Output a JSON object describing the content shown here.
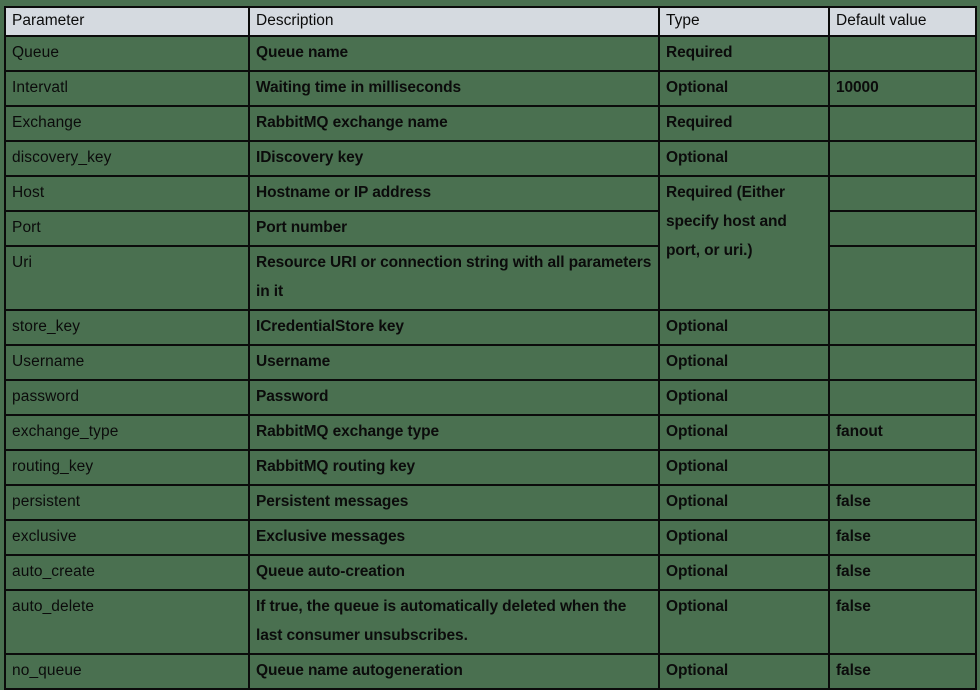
{
  "table": {
    "columns": [
      "Parameter",
      "Description",
      "Type",
      "Default value"
    ],
    "rows": [
      {
        "parameter": "Queue",
        "description": "Queue name",
        "type": "Required",
        "default": ""
      },
      {
        "parameter": "Intervatl",
        "description": "Waiting time in milliseconds",
        "type": "Optional",
        "default": "10000"
      },
      {
        "parameter": "Exchange",
        "description": "RabbitMQ exchange name",
        "type": "Required",
        "default": ""
      },
      {
        "parameter": "discovery_key",
        "description": "IDiscovery key",
        "type": "Optional",
        "default": ""
      },
      {
        "parameter": "Host",
        "description": "Hostname or IP address",
        "type": "Required (Either specify host and port, or uri.)",
        "type_merged_rowspan": 3,
        "default": ""
      },
      {
        "parameter": "Port",
        "description": "Port number",
        "type": null,
        "default": ""
      },
      {
        "parameter": "Uri",
        "description": "Resource URI or connection string with all parameters in it",
        "type": null,
        "default": ""
      },
      {
        "parameter": "store_key",
        "description": "ICredentialStore key",
        "type": "Optional",
        "default": ""
      },
      {
        "parameter": "Username",
        "description": "Username",
        "type": "Optional",
        "default": ""
      },
      {
        "parameter": "password",
        "description": "Password",
        "type": "Optional",
        "default": ""
      },
      {
        "parameter": "exchange_type",
        "description": "RabbitMQ exchange type",
        "type": "Optional",
        "default": "fanout"
      },
      {
        "parameter": "routing_key",
        "description": "RabbitMQ routing key",
        "type": "Optional",
        "default": ""
      },
      {
        "parameter": "persistent",
        "description": "Persistent messages",
        "type": "Optional",
        "default": "false"
      },
      {
        "parameter": "exclusive",
        "description": "Exclusive messages",
        "type": "Optional",
        "default": "false"
      },
      {
        "parameter": "auto_create",
        "description": "Queue auto-creation",
        "type": "Optional",
        "default": "false"
      },
      {
        "parameter": "auto_delete",
        "description": "If true, the queue is automatically deleted when the last consumer unsubscribes.",
        "type": "Optional",
        "default": "false"
      },
      {
        "parameter": "no_queue",
        "description": "Queue name autogeneration",
        "type": "Optional",
        "default": "false"
      }
    ]
  },
  "colors": {
    "page_background": "#4a7050",
    "header_background": "#d5dae0",
    "border": "#0b0b0b",
    "text": "#0b0b0b"
  }
}
